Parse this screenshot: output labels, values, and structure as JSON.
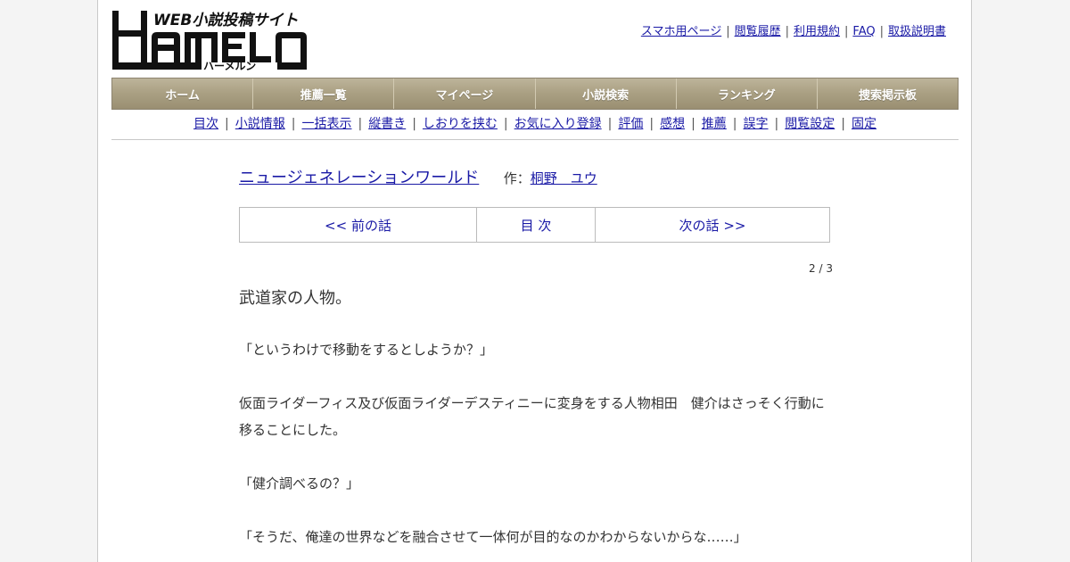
{
  "logo": {
    "tagline": "WEB小説投稿サイト",
    "wordmark": "HAMELN",
    "kana": "ハーメルン"
  },
  "top_links": [
    "スマホ用ページ",
    "閲覧履歴",
    "利用規約",
    "FAQ",
    "取扱説明書"
  ],
  "main_nav": [
    "ホーム",
    "推薦一覧",
    "マイページ",
    "小説検索",
    "ランキング",
    "捜索掲示板"
  ],
  "sub_nav": [
    "目次",
    "小説情報",
    "一括表示",
    "縦書き",
    "しおりを挟む",
    "お気に入り登録",
    "評価",
    "感想",
    "推薦",
    "誤字",
    "閲覧設定",
    "固定"
  ],
  "novel": {
    "title": "ニュージェネレーションワールド",
    "author_prefix": "作：",
    "author": "桐野　ユウ"
  },
  "pager": {
    "prev": "<< 前の話",
    "toc": "目 次",
    "next": "次の話 >>"
  },
  "page_count": "2 / 3",
  "chapter_title": "武道家の人物。",
  "body_lines": [
    "「というわけで移動をするとしようか？」",
    "",
    "仮面ライダーフィス及び仮面ライダーデスティニーに変身をする人物相田　健介はさっそく行動に",
    "移ることにした。",
    "",
    "「健介調べるの？」",
    "",
    "「そうだ、俺達の世界などを融合させて一体何が目的なのかわからないからな‥‥‥」"
  ],
  "colors": {
    "link": "#1a1aa6",
    "nav_bg": "#a99f82",
    "page_bg": "#f4f4f4"
  }
}
